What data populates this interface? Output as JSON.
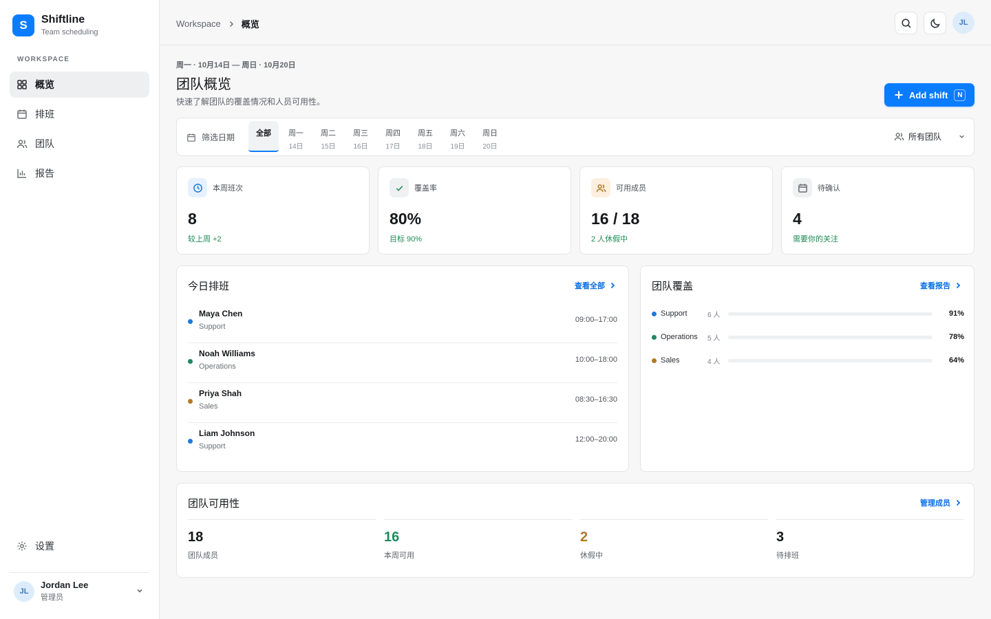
{
  "brand": {
    "logo_letter": "S",
    "name": "Shiftline",
    "subtitle": "Team scheduling"
  },
  "sidebar": {
    "section_label": "WORKSPACE",
    "items": [
      {
        "label": "概览",
        "icon": "grid-icon",
        "active": true
      },
      {
        "label": "排班",
        "icon": "calendar-icon",
        "active": false
      },
      {
        "label": "团队",
        "icon": "users-icon",
        "active": false
      },
      {
        "label": "报告",
        "icon": "bar-chart-icon",
        "active": false
      }
    ],
    "settings_label": "设置"
  },
  "user": {
    "initials": "JL",
    "name": "Jordan Lee",
    "role": "管理员"
  },
  "topbar": {
    "breadcrumb_root": "Workspace",
    "breadcrumb_current": "概览",
    "avatar_initials": "JL"
  },
  "header": {
    "date_range": "周一 · 10月14日 — 周日 · 10月20日",
    "title": "团队概览",
    "subtitle": "快速了解团队的覆盖情况和人员可用性。",
    "add_button": "Add shift",
    "add_shortcut": "N"
  },
  "filter": {
    "label": "筛选日期",
    "tabs": [
      {
        "day": "全部",
        "date": "",
        "active": true
      },
      {
        "day": "周一",
        "date": "14日"
      },
      {
        "day": "周二",
        "date": "15日"
      },
      {
        "day": "周三",
        "date": "16日"
      },
      {
        "day": "周四",
        "date": "17日"
      },
      {
        "day": "周五",
        "date": "18日"
      },
      {
        "day": "周六",
        "date": "19日"
      },
      {
        "day": "周日",
        "date": "20日"
      }
    ],
    "team_select": "所有团队"
  },
  "stats": [
    {
      "label": "本周班次",
      "value": "8",
      "note": "较上周 +2",
      "icon": "clock-icon"
    },
    {
      "label": "覆盖率",
      "value": "80%",
      "note": "目标 90%",
      "icon": "check-icon"
    },
    {
      "label": "可用成员",
      "value": "16 / 18",
      "note": "2 人休假中",
      "icon": "users-icon"
    },
    {
      "label": "待确认",
      "value": "4",
      "note": "需要你的关注",
      "icon": "calendar-icon"
    }
  ],
  "shifts": {
    "title": "今日排班",
    "link": "查看全部",
    "rows": [
      {
        "name": "Maya Chen",
        "team": "Support",
        "time": "09:00–17:00",
        "color": "#1a7be0"
      },
      {
        "name": "Noah Williams",
        "team": "Operations",
        "time": "10:00–18:00",
        "color": "#1f8a5c"
      },
      {
        "name": "Priya Shah",
        "team": "Sales",
        "time": "08:30–16:30",
        "color": "#b27a22"
      },
      {
        "name": "Liam Johnson",
        "team": "Support",
        "time": "12:00–20:00",
        "color": "#1a7be0"
      }
    ]
  },
  "coverage": {
    "title": "团队覆盖",
    "link": "查看报告",
    "rows": [
      {
        "team": "Support",
        "count": "6 人",
        "pct": "91%",
        "fraction": 0.91,
        "color": "#1a7be0"
      },
      {
        "team": "Operations",
        "count": "5 人",
        "pct": "78%",
        "fraction": 0.78,
        "color": "#1f8a5c"
      },
      {
        "team": "Sales",
        "count": "4 人",
        "pct": "64%",
        "fraction": 0.64,
        "color": "#b27a22"
      }
    ]
  },
  "availability": {
    "title": "团队可用性",
    "link": "管理成员",
    "cells": [
      {
        "value": "18",
        "label": "团队成员",
        "color": "#15171a"
      },
      {
        "value": "16",
        "label": "本周可用",
        "color": "#1f8a5c"
      },
      {
        "value": "2",
        "label": "休假中",
        "color": "#b27a22"
      },
      {
        "value": "3",
        "label": "待排班",
        "color": "#15171a"
      }
    ]
  },
  "colors": {
    "accent": "#0a7cff",
    "positive": "#1d8a53"
  }
}
